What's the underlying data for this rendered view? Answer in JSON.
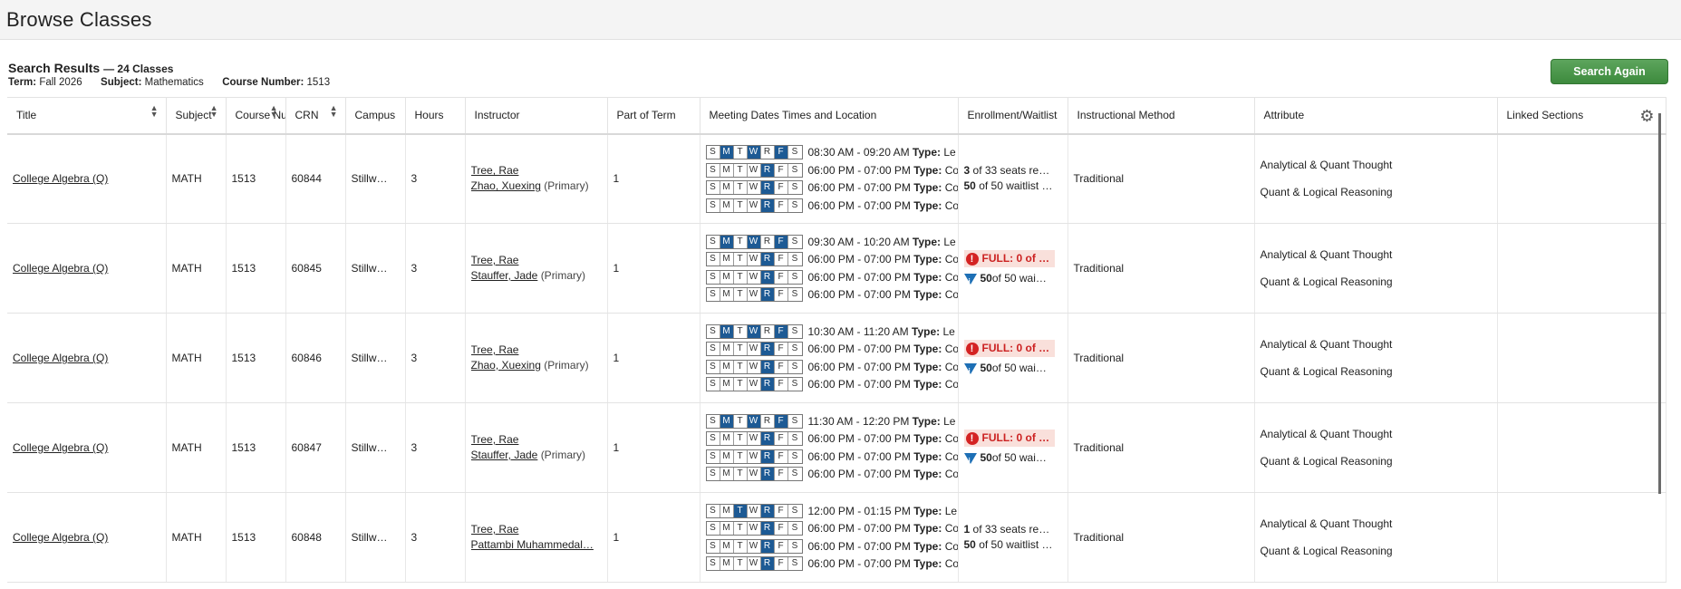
{
  "page": {
    "title": "Browse Classes"
  },
  "summary": {
    "heading": "Search Results",
    "count": "— 24 Classes",
    "term_label": "Term:",
    "term": "Fall 2026",
    "subject_label": "Subject:",
    "subject": "Mathematics",
    "course_label": "Course Number:",
    "course": "1513",
    "search_again": "Search Again"
  },
  "columns": {
    "title": "Title",
    "subject": "Subject",
    "course_number": "Course Nu",
    "crn": "CRN",
    "campus": "Campus",
    "hours": "Hours",
    "instructor": "Instructor",
    "part_of_term": "Part of Term",
    "meeting": "Meeting Dates Times and Location",
    "enrollment": "Enrollment/Waitlist",
    "method": "Instructional Method",
    "attribute": "Attribute",
    "linked": "Linked Sections"
  },
  "day_letters": [
    "S",
    "M",
    "T",
    "W",
    "R",
    "F",
    "S"
  ],
  "rows": [
    {
      "title": "College Algebra (Q)",
      "subject": "MATH",
      "course": "1513",
      "crn": "60844",
      "campus": "Stillw…",
      "hours": "3",
      "instructor1": "Tree, Rae",
      "instructor2": "Zhao, Xuexing",
      "primary": "(Primary)",
      "part": "1",
      "meetings": [
        {
          "days": [
            0,
            1,
            0,
            1,
            0,
            1,
            0
          ],
          "time": "08:30 AM - 09:20 AM",
          "type_label": "Type:",
          "type": "Le"
        },
        {
          "days": [
            0,
            0,
            0,
            0,
            1,
            0,
            0
          ],
          "time": "06:00 PM - 07:00 PM",
          "type_label": "Type:",
          "type": "Co"
        },
        {
          "days": [
            0,
            0,
            0,
            0,
            1,
            0,
            0
          ],
          "time": "06:00 PM - 07:00 PM",
          "type_label": "Type:",
          "type": "Co"
        },
        {
          "days": [
            0,
            0,
            0,
            0,
            1,
            0,
            0
          ],
          "time": "06:00 PM - 07:00 PM",
          "type_label": "Type:",
          "type": "Co"
        }
      ],
      "enroll_full": false,
      "enroll_line1_num": "3",
      "enroll_line1": "of 33 seats re…",
      "enroll_line2_num": "50",
      "enroll_line2": "of 50 waitlist …",
      "method": "Traditional",
      "attr1": "Analytical & Quant Thought",
      "attr2": "Quant & Logical Reasoning"
    },
    {
      "title": "College Algebra (Q)",
      "subject": "MATH",
      "course": "1513",
      "crn": "60845",
      "campus": "Stillw…",
      "hours": "3",
      "instructor1": "Tree, Rae",
      "instructor2": "Stauffer, Jade",
      "primary": "(Primary)",
      "part": "1",
      "meetings": [
        {
          "days": [
            0,
            1,
            0,
            1,
            0,
            1,
            0
          ],
          "time": "09:30 AM - 10:20 AM",
          "type_label": "Type:",
          "type": "Le"
        },
        {
          "days": [
            0,
            0,
            0,
            0,
            1,
            0,
            0
          ],
          "time": "06:00 PM - 07:00 PM",
          "type_label": "Type:",
          "type": "Co"
        },
        {
          "days": [
            0,
            0,
            0,
            0,
            1,
            0,
            0
          ],
          "time": "06:00 PM - 07:00 PM",
          "type_label": "Type:",
          "type": "Co"
        },
        {
          "days": [
            0,
            0,
            0,
            0,
            1,
            0,
            0
          ],
          "time": "06:00 PM - 07:00 PM",
          "type_label": "Type:",
          "type": "Co"
        }
      ],
      "enroll_full": true,
      "full_text": "FULL: 0 of …",
      "wait_num": "50",
      "wait_text": "of 50 wai…",
      "method": "Traditional",
      "attr1": "Analytical & Quant Thought",
      "attr2": "Quant & Logical Reasoning"
    },
    {
      "title": "College Algebra (Q)",
      "subject": "MATH",
      "course": "1513",
      "crn": "60846",
      "campus": "Stillw…",
      "hours": "3",
      "instructor1": "Tree, Rae",
      "instructor2": "Zhao, Xuexing",
      "primary": "(Primary)",
      "part": "1",
      "meetings": [
        {
          "days": [
            0,
            1,
            0,
            1,
            0,
            1,
            0
          ],
          "time": "10:30 AM - 11:20 AM",
          "type_label": "Type:",
          "type": "Le"
        },
        {
          "days": [
            0,
            0,
            0,
            0,
            1,
            0,
            0
          ],
          "time": "06:00 PM - 07:00 PM",
          "type_label": "Type:",
          "type": "Co"
        },
        {
          "days": [
            0,
            0,
            0,
            0,
            1,
            0,
            0
          ],
          "time": "06:00 PM - 07:00 PM",
          "type_label": "Type:",
          "type": "Co"
        },
        {
          "days": [
            0,
            0,
            0,
            0,
            1,
            0,
            0
          ],
          "time": "06:00 PM - 07:00 PM",
          "type_label": "Type:",
          "type": "Co"
        }
      ],
      "enroll_full": true,
      "full_text": "FULL: 0 of …",
      "wait_num": "50",
      "wait_text": "of 50 wai…",
      "method": "Traditional",
      "attr1": "Analytical & Quant Thought",
      "attr2": "Quant & Logical Reasoning"
    },
    {
      "title": "College Algebra (Q)",
      "subject": "MATH",
      "course": "1513",
      "crn": "60847",
      "campus": "Stillw…",
      "hours": "3",
      "instructor1": "Tree, Rae",
      "instructor2": "Stauffer, Jade",
      "primary": "(Primary)",
      "part": "1",
      "meetings": [
        {
          "days": [
            0,
            1,
            0,
            1,
            0,
            1,
            0
          ],
          "time": "11:30 AM - 12:20 PM",
          "type_label": "Type:",
          "type": "Le"
        },
        {
          "days": [
            0,
            0,
            0,
            0,
            1,
            0,
            0
          ],
          "time": "06:00 PM - 07:00 PM",
          "type_label": "Type:",
          "type": "Co"
        },
        {
          "days": [
            0,
            0,
            0,
            0,
            1,
            0,
            0
          ],
          "time": "06:00 PM - 07:00 PM",
          "type_label": "Type:",
          "type": "Co"
        },
        {
          "days": [
            0,
            0,
            0,
            0,
            1,
            0,
            0
          ],
          "time": "06:00 PM - 07:00 PM",
          "type_label": "Type:",
          "type": "Co"
        }
      ],
      "enroll_full": true,
      "full_text": "FULL: 0 of …",
      "wait_num": "50",
      "wait_text": "of 50 wai…",
      "method": "Traditional",
      "attr1": "Analytical & Quant Thought",
      "attr2": "Quant & Logical Reasoning"
    },
    {
      "title": "College Algebra (Q)",
      "subject": "MATH",
      "course": "1513",
      "crn": "60848",
      "campus": "Stillw…",
      "hours": "3",
      "instructor1": "Tree, Rae",
      "instructor2": "Pattambi Muhammedal…",
      "primary": "",
      "part": "1",
      "meetings": [
        {
          "days": [
            0,
            0,
            1,
            0,
            1,
            0,
            0
          ],
          "time": "12:00 PM - 01:15 PM",
          "type_label": "Type:",
          "type": "Le"
        },
        {
          "days": [
            0,
            0,
            0,
            0,
            1,
            0,
            0
          ],
          "time": "06:00 PM - 07:00 PM",
          "type_label": "Type:",
          "type": "Co"
        },
        {
          "days": [
            0,
            0,
            0,
            0,
            1,
            0,
            0
          ],
          "time": "06:00 PM - 07:00 PM",
          "type_label": "Type:",
          "type": "Co"
        },
        {
          "days": [
            0,
            0,
            0,
            0,
            1,
            0,
            0
          ],
          "time": "06:00 PM - 07:00 PM",
          "type_label": "Type:",
          "type": "Co"
        }
      ],
      "enroll_full": false,
      "enroll_line1_num": "1",
      "enroll_line1": "of 33 seats re…",
      "enroll_line2_num": "50",
      "enroll_line2": "of 50 waitlist …",
      "method": "Traditional",
      "attr1": "Analytical & Quant Thought",
      "attr2": "Quant & Logical Reasoning"
    }
  ],
  "colors": {
    "day_on": "#1d5a94",
    "full_bg": "#f9e0db",
    "full_text": "#cc2222",
    "button": "#4a964a"
  },
  "icons": {
    "settings": "gear-icon",
    "sort": "sort-icon",
    "full": "exclamation-icon",
    "waitlist": "waitlist-icon"
  }
}
